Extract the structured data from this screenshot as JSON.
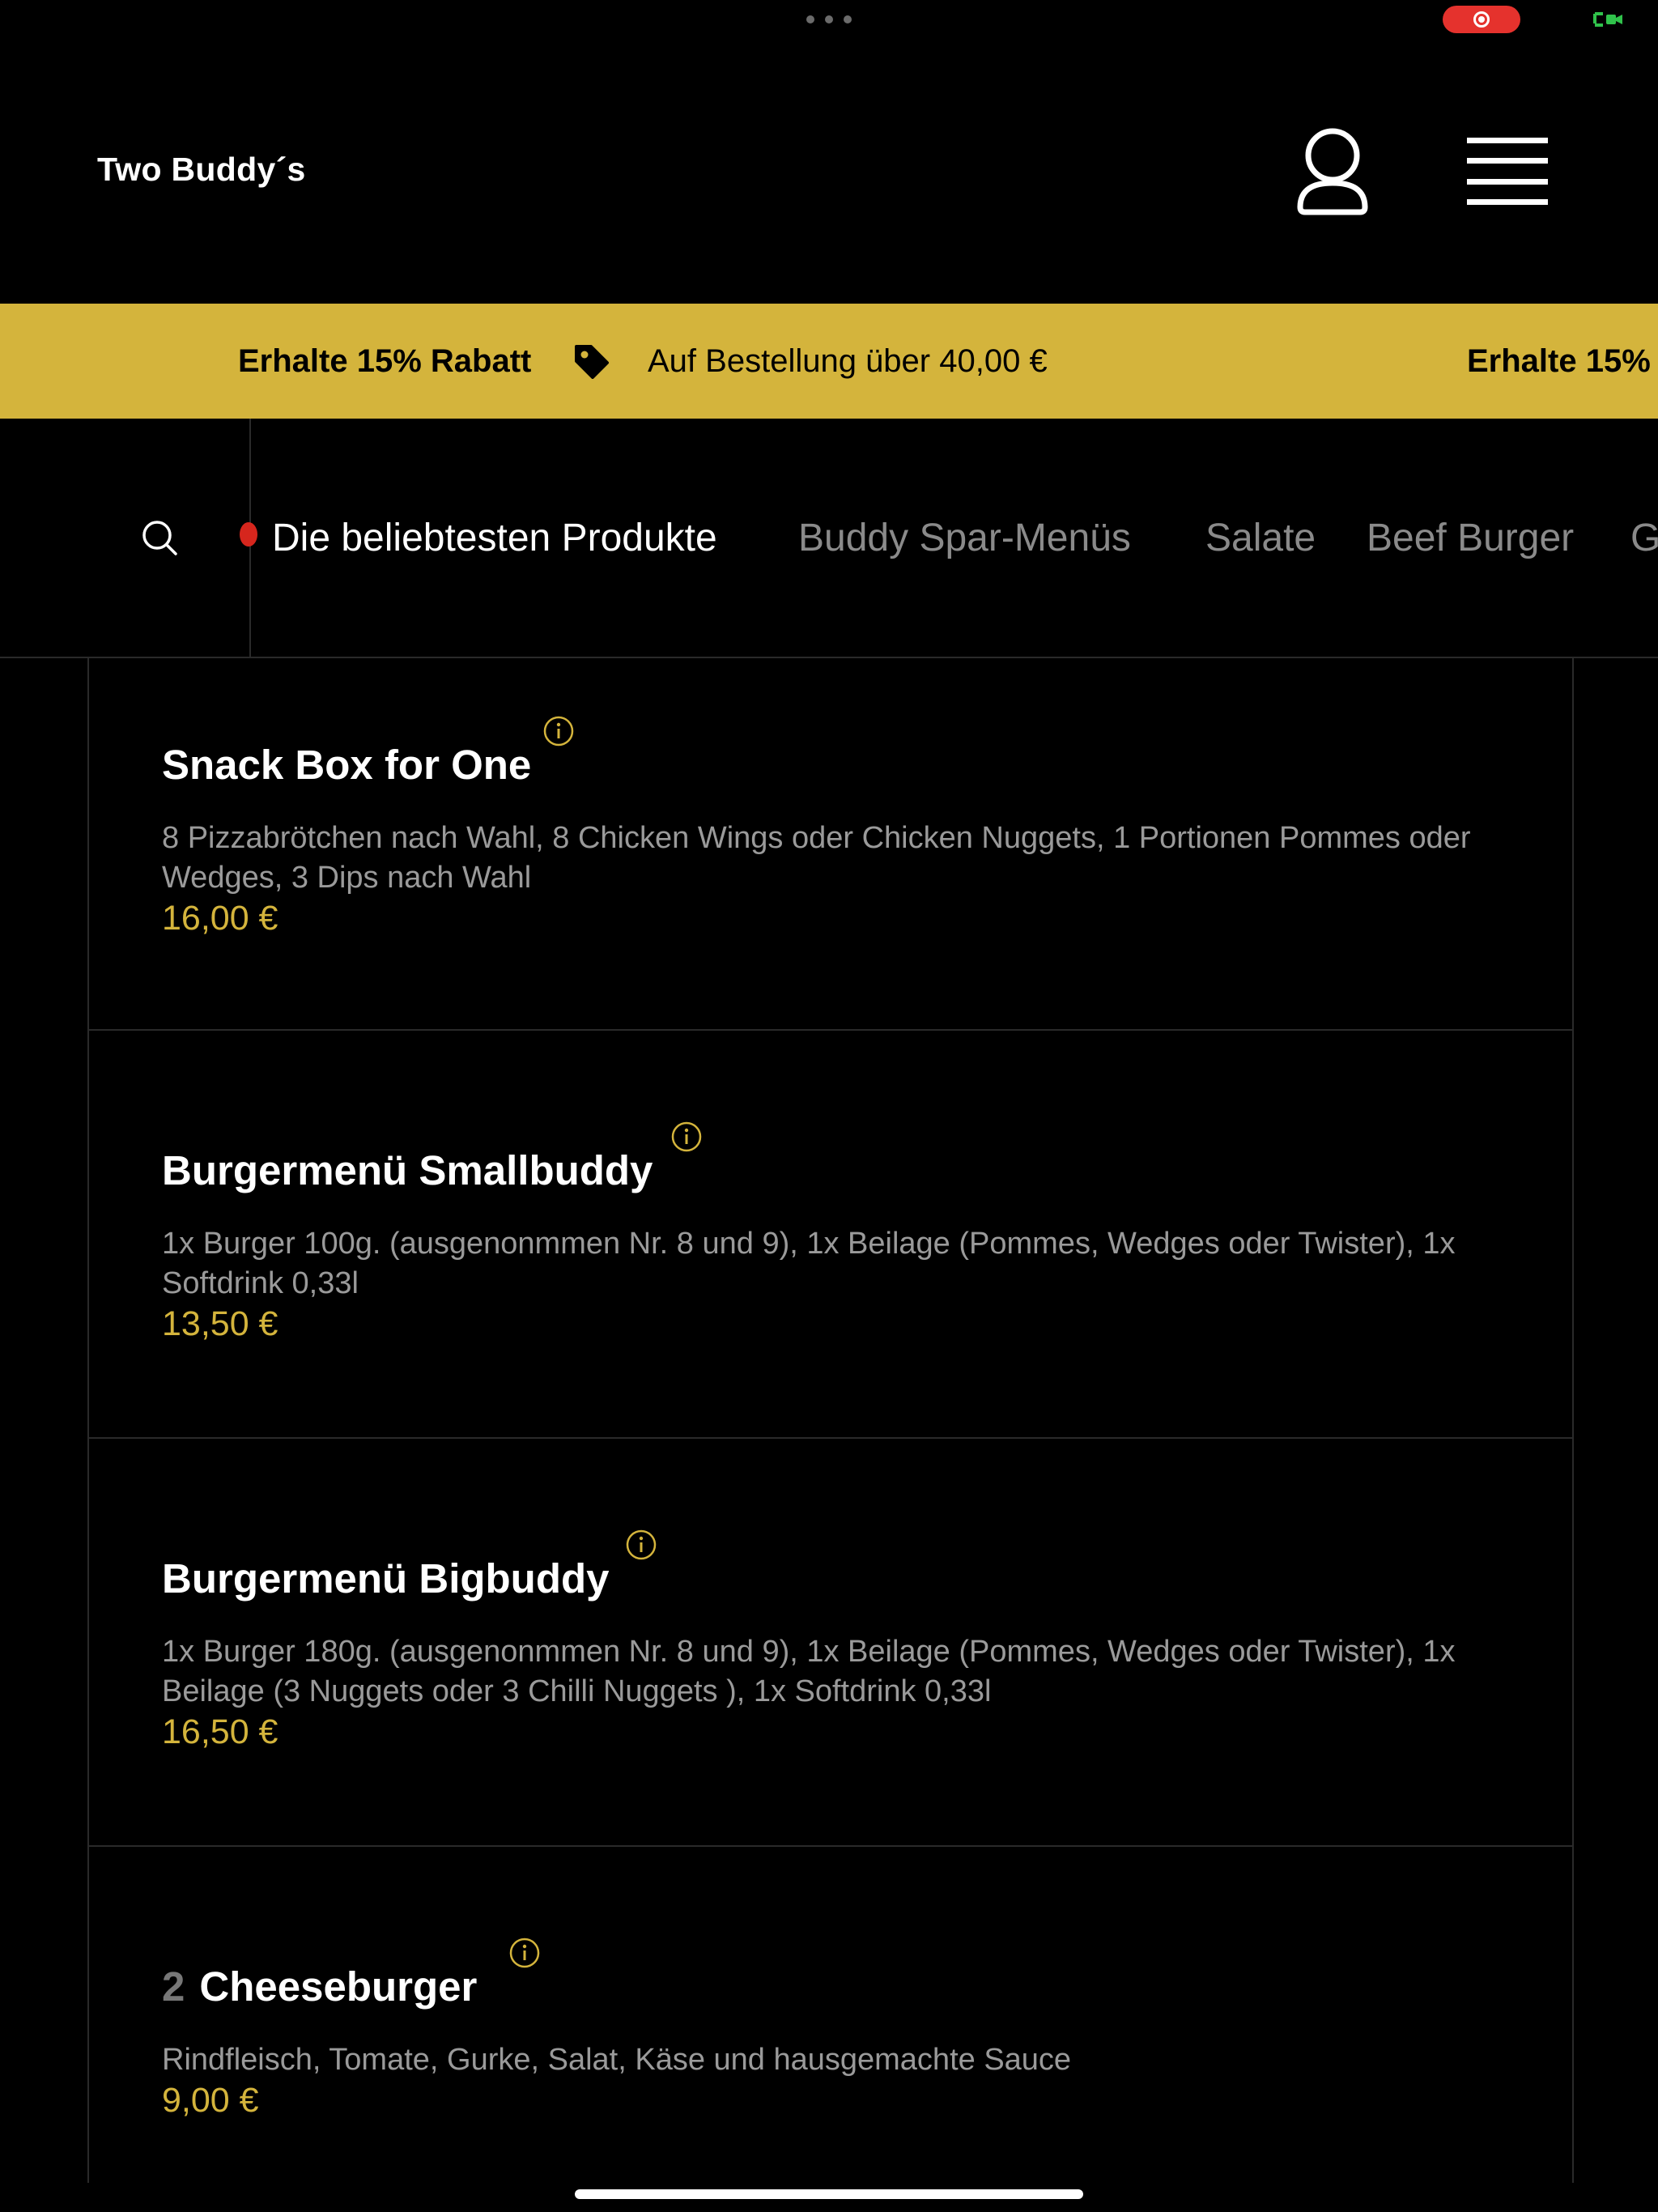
{
  "header": {
    "brand": "Two Buddy´s"
  },
  "promo": {
    "headline": "Erhalte 15% Rabatt",
    "condition": "Auf Bestellung über 40,00 €",
    "headline_repeat": "Erhalte 15%"
  },
  "categories": [
    {
      "label": "Die beliebtesten Produkte",
      "active": true
    },
    {
      "label": "Buddy Spar-Menüs",
      "active": false
    },
    {
      "label": "Salate",
      "active": false
    },
    {
      "label": "Beef Burger",
      "active": false
    },
    {
      "label": "G",
      "active": false
    }
  ],
  "products": [
    {
      "number": "",
      "title": "Snack Box for One",
      "description": "8 Pizzabrötchen nach Wahl, 8 Chicken Wings oder Chicken Nuggets,  1 Portionen Pommes oder Wedges, 3 Dips nach Wahl",
      "price": "16,00 €"
    },
    {
      "number": "",
      "title": "Burgermenü Smallbuddy",
      "description": "1x Burger 100g. (ausgenonmmen Nr. 8 und 9), 1x Beilage (Pommes, Wedges oder Twister), 1x Softdrink 0,33l",
      "price": "13,50 €"
    },
    {
      "number": "",
      "title": "Burgermenü Bigbuddy",
      "description": "1x Burger 180g. (ausgenonmmen Nr. 8 und 9), 1x Beilage (Pommes, Wedges oder Twister), 1x Beilage (3 Nuggets oder 3 Chilli Nuggets ), 1x Softdrink 0,33l",
      "price": "16,50 €"
    },
    {
      "number": "2",
      "title": "Cheeseburger",
      "description": "Rindfleisch, Tomate, Gurke, Salat, Käse und hausgemachte Sauce",
      "price": "9,00 €"
    }
  ],
  "colors": {
    "background": "#000000",
    "accent": "#d4b43c",
    "text_secondary": "#9a9a9a",
    "divider": "#2a2a2a",
    "recording": "#e5322d"
  },
  "icons": [
    "user-icon",
    "hamburger-menu-icon",
    "tag-icon",
    "search-icon",
    "info-icon"
  ]
}
